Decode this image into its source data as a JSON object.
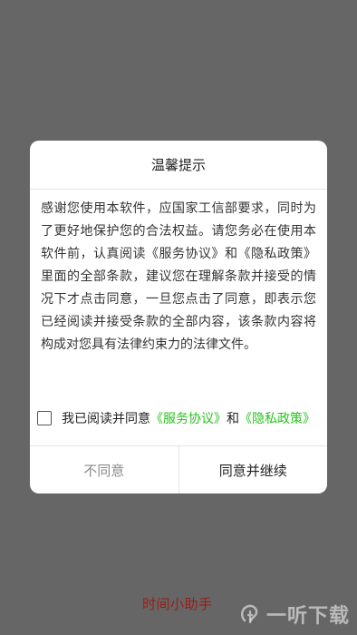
{
  "dialog": {
    "title": "温馨提示",
    "body": "感谢您使用本软件，应国家工信部要求，同时为了更好地保护您的合法权益。请您务必在使用本软件前，认真阅读《服务协议》和《隐私政策》里面的全部条款，建议您在理解条款并接受的情况下才点击同意，一旦您点击了同意，即表示您已经阅读并接受条款的全部内容，该条款内容将构成对您具有法律约束力的法律文件。",
    "agree_prefix": "我已阅读并同意",
    "service_link": "《服务协议》",
    "and_text": "和",
    "privacy_link": "《隐私政策》",
    "checked": false,
    "disagree_label": "不同意",
    "agree_label": "同意并继续"
  },
  "app_name": "时间小助手",
  "watermark": {
    "text": "一听下载",
    "icon": "ear-logo-icon"
  },
  "colors": {
    "link": "#27c31b",
    "app_name": "#9a1e14",
    "overlay": "#666666"
  }
}
